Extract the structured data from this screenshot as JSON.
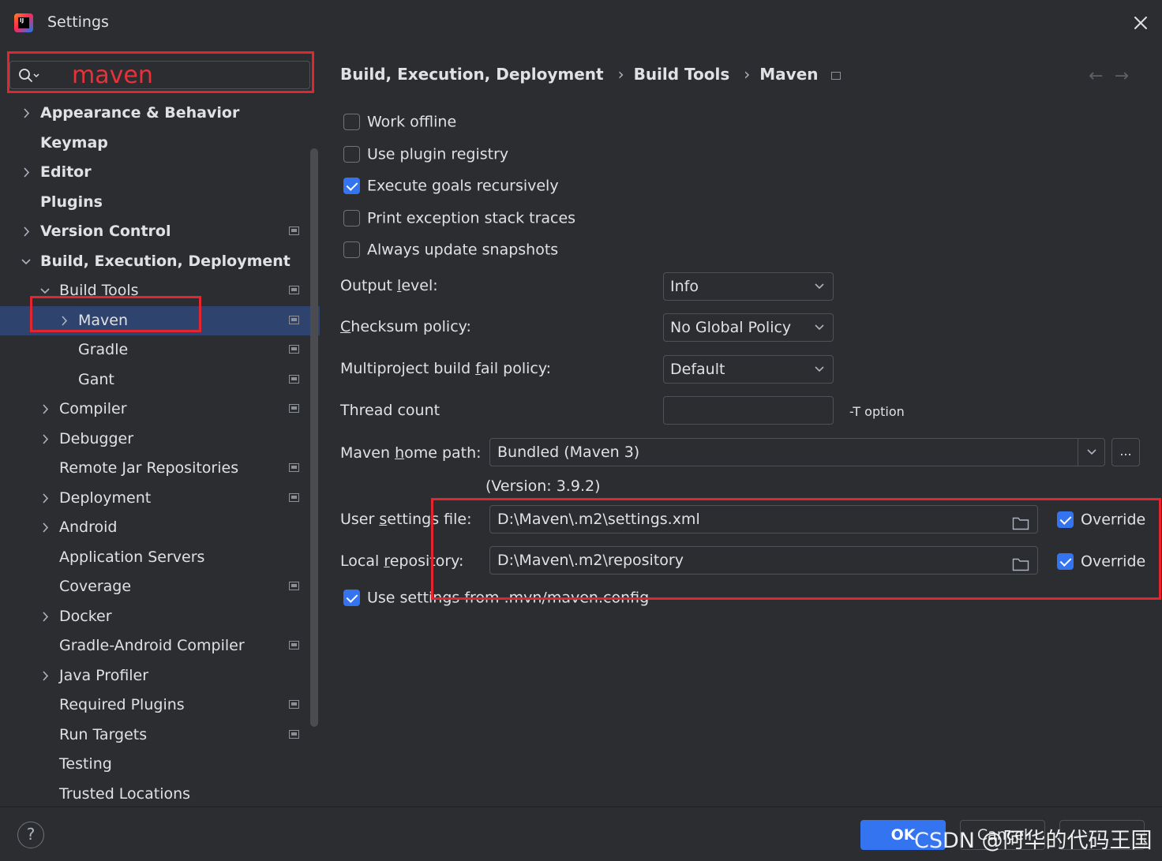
{
  "window": {
    "title": "Settings"
  },
  "search": {
    "value": "maven"
  },
  "sidebar": {
    "items": [
      {
        "label": "Appearance & Behavior",
        "level": 0,
        "chevron": "right",
        "project": false
      },
      {
        "label": "Keymap",
        "level": 0,
        "chevron": "",
        "project": false
      },
      {
        "label": "Editor",
        "level": 0,
        "chevron": "right",
        "project": false
      },
      {
        "label": "Plugins",
        "level": 0,
        "chevron": "",
        "project": false
      },
      {
        "label": "Version Control",
        "level": 0,
        "chevron": "right",
        "project": true
      },
      {
        "label": "Build, Execution, Deployment",
        "level": 0,
        "chevron": "down",
        "project": false
      },
      {
        "label": "Build Tools",
        "level": 1,
        "chevron": "down",
        "project": true
      },
      {
        "label": "Maven",
        "level": 2,
        "chevron": "right",
        "project": true,
        "selected": true
      },
      {
        "label": "Gradle",
        "level": 2,
        "chevron": "",
        "project": true
      },
      {
        "label": "Gant",
        "level": 2,
        "chevron": "",
        "project": true
      },
      {
        "label": "Compiler",
        "level": 1,
        "chevron": "right",
        "project": true
      },
      {
        "label": "Debugger",
        "level": 1,
        "chevron": "right",
        "project": false
      },
      {
        "label": "Remote Jar Repositories",
        "level": 1,
        "chevron": "",
        "project": true
      },
      {
        "label": "Deployment",
        "level": 1,
        "chevron": "right",
        "project": true
      },
      {
        "label": "Android",
        "level": 1,
        "chevron": "right",
        "project": false
      },
      {
        "label": "Application Servers",
        "level": 1,
        "chevron": "",
        "project": false
      },
      {
        "label": "Coverage",
        "level": 1,
        "chevron": "",
        "project": true
      },
      {
        "label": "Docker",
        "level": 1,
        "chevron": "right",
        "project": false
      },
      {
        "label": "Gradle-Android Compiler",
        "level": 1,
        "chevron": "",
        "project": true
      },
      {
        "label": "Java Profiler",
        "level": 1,
        "chevron": "right",
        "project": false
      },
      {
        "label": "Required Plugins",
        "level": 1,
        "chevron": "",
        "project": true
      },
      {
        "label": "Run Targets",
        "level": 1,
        "chevron": "",
        "project": true
      },
      {
        "label": "Testing",
        "level": 1,
        "chevron": "",
        "project": false
      },
      {
        "label": "Trusted Locations",
        "level": 1,
        "chevron": "",
        "project": false
      }
    ]
  },
  "breadcrumb": [
    "Build, Execution, Deployment",
    "Build Tools",
    "Maven"
  ],
  "checkboxes": {
    "work_offline": {
      "label": "Work offline",
      "checked": false
    },
    "plugin_registry": {
      "label": "Use plugin registry",
      "checked": false
    },
    "execute_recursively": {
      "label": "Execute goals recursively",
      "checked": true
    },
    "print_stack": {
      "label": "Print exception stack traces",
      "checked": false
    },
    "update_snapshots": {
      "label": "Always update snapshots",
      "checked": false
    },
    "use_mvn_config": {
      "label": "Use settings from .mvn/maven.config",
      "checked": true
    }
  },
  "form": {
    "output_level": {
      "label_pre": "Output ",
      "label_ul": "l",
      "label_post": "evel:",
      "value": "Info"
    },
    "checksum": {
      "label_pre": "",
      "label_ul": "C",
      "label_post": "hecksum policy:",
      "value": "No Global Policy"
    },
    "fail_policy": {
      "label_pre": "Multiproject build ",
      "label_ul": "f",
      "label_post": "ail policy:",
      "value": "Default"
    },
    "thread_count": {
      "label": "Thread count",
      "value": "",
      "hint": "-T option"
    },
    "maven_home": {
      "label_pre": "Maven ",
      "label_ul": "h",
      "label_post": "ome path:",
      "value": "Bundled (Maven 3)",
      "version": "(Version: 3.9.2)",
      "browse": "..."
    },
    "user_settings": {
      "label_pre": "User ",
      "label_ul": "s",
      "label_post": "ettings file:",
      "value": "D:\\Maven\\.m2\\settings.xml",
      "override_label": "Override",
      "override_checked": true
    },
    "local_repo": {
      "label_pre": "Local ",
      "label_ul": "r",
      "label_post": "epository:",
      "value": "D:\\Maven\\.m2\\repository",
      "override_label": "Override",
      "override_checked": true
    }
  },
  "footer": {
    "help": "?",
    "ok": "OK",
    "cancel": "Cancel",
    "watermark": "CSDN @阿华的代码王国"
  },
  "colors": {
    "accent": "#3574f0",
    "selection": "#2e436e",
    "annotation_red": "#e3252d",
    "background": "#2b2d30"
  },
  "icons": {
    "app": "intellij-idea-icon",
    "search": "search-icon",
    "close": "close-icon",
    "folder": "folder-icon"
  }
}
